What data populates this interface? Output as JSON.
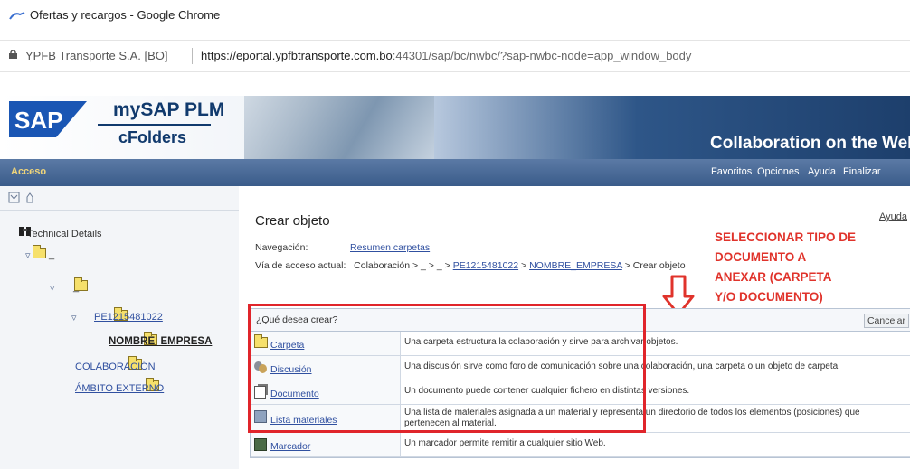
{
  "browser": {
    "title": "Ofertas y recargos - Google Chrome",
    "site": "YPFB Transporte S.A. [BO]",
    "url_host": "https://eportal.ypfbtransporte.com.bo",
    "url_rest": ":44301/sap/bc/nwbc/?sap-nwbc-node=app_window_body"
  },
  "header": {
    "logo": "SAP",
    "product_line1": "mySAP PLM",
    "product_line2": "cFolders",
    "tagline": "Collaboration on the Web"
  },
  "navbar": {
    "acceso": "Acceso",
    "links": [
      "Favoritos",
      "Opciones",
      "Ayuda",
      "Finalizar"
    ]
  },
  "tree": {
    "root": "Technical Details",
    "node_underscore": "_",
    "folder_pe": "PE1215481022",
    "folder_empresa": "NOMBRE_EMPRESA",
    "folder_colab": "COLABORACIÓN",
    "folder_ambito": "ÁMBITO EXTERNO"
  },
  "page": {
    "title": "Crear objeto",
    "help": "Ayuda",
    "nav_label": "Navegación:",
    "nav_link": "Resumen carpetas",
    "path_label": "Vía de acceso actual:",
    "path_p1": "Colaboración",
    "path_p2": ">",
    "path_p3": "_",
    "path_p4": ">",
    "path_p5": "_",
    "path_p6": ">",
    "path_link1": "PE1215481022",
    "path_p7": ">",
    "path_link2": "NOMBRE_EMPRESA",
    "path_p8": "> Crear objeto"
  },
  "annotation": {
    "line1": "SELECCIONAR TIPO DE",
    "line2": "DOCUMENTO A",
    "line3": "ANEXAR (CARPETA",
    "line4": "Y/O DOCUMENTO)",
    "color": "#e0332b"
  },
  "table": {
    "question": "¿Qué desea crear?",
    "cancel": "Cancelar",
    "rows": [
      {
        "label": "Carpeta",
        "icon": "folder-icon",
        "desc": "Una carpeta estructura la colaboración y sirve para archivar objetos."
      },
      {
        "label": "Discusión",
        "icon": "discussion-icon",
        "desc": "Una discusión sirve como foro de comunicación sobre una colaboración, una carpeta o un objeto de carpeta."
      },
      {
        "label": "Documento",
        "icon": "document-icon",
        "desc": "Un documento puede contener cualquier fichero en distintas versiones."
      },
      {
        "label": "Lista materiales",
        "icon": "bom-icon",
        "desc": "Una lista de materiales asignada a un material y representa un directorio de todos los elementos (posiciones) que pertenecen al material."
      },
      {
        "label": "Marcador",
        "icon": "bookmark-icon",
        "desc": "Un marcador permite remitir a cualquier sitio Web."
      }
    ]
  }
}
